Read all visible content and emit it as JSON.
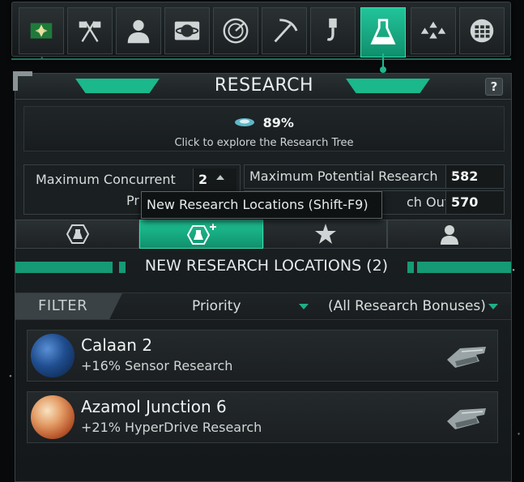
{
  "toolbar": {
    "items": [
      {
        "name": "empire-flag",
        "icon": "star-flag-icon"
      },
      {
        "name": "diplomacy",
        "icon": "crossed-flags-icon"
      },
      {
        "name": "characters",
        "icon": "person-icon"
      },
      {
        "name": "colonies",
        "icon": "planet-icon"
      },
      {
        "name": "intelligence",
        "icon": "radar-icon"
      },
      {
        "name": "mining",
        "icon": "pickaxe-icon"
      },
      {
        "name": "construction",
        "icon": "crane-hook-icon"
      },
      {
        "name": "research",
        "icon": "flask-icon",
        "active": true
      },
      {
        "name": "fleets",
        "icon": "triangle-formation-icon"
      },
      {
        "name": "designs",
        "icon": "grid-icon"
      }
    ]
  },
  "panel": {
    "title": "RESEARCH",
    "help_label": "?",
    "tree": {
      "percent": "89%",
      "hint": "Click to explore the Research Tree"
    },
    "stats": {
      "max_concurrent_label": "Maximum Concurrent",
      "max_concurrent_label_line2": "Pr",
      "max_concurrent_value": "2",
      "max_potential_label": "Maximum Potential Research",
      "max_potential_value": "582",
      "output_label": "ch Output",
      "output_value": "570"
    },
    "tooltip": "New Research Locations (Shift-F9)",
    "tabs": [
      {
        "name": "research-projects",
        "icon": "hex-flask-icon"
      },
      {
        "name": "new-research-locations",
        "icon": "hex-flask-plus-icon",
        "active": true
      },
      {
        "name": "special-research",
        "icon": "star-icon"
      },
      {
        "name": "scientists",
        "icon": "person-icon"
      }
    ],
    "section_title": "NEW RESEARCH LOCATIONS (2)",
    "filter": {
      "label": "FILTER",
      "sort_value": "Priority",
      "bonus_value": "(All Research Bonuses)"
    },
    "locations": [
      {
        "name": "Calaan 2",
        "bonus": "+16% Sensor Research",
        "planet_color": "#1f4d8f"
      },
      {
        "name": "Azamol Junction 6",
        "bonus": "+21% HyperDrive Research",
        "planet_color": "#d9824a"
      }
    ]
  },
  "colors": {
    "accent": "#1bb88c",
    "accent_dark": "#10916d",
    "panel_bg": "#1a1f21"
  }
}
